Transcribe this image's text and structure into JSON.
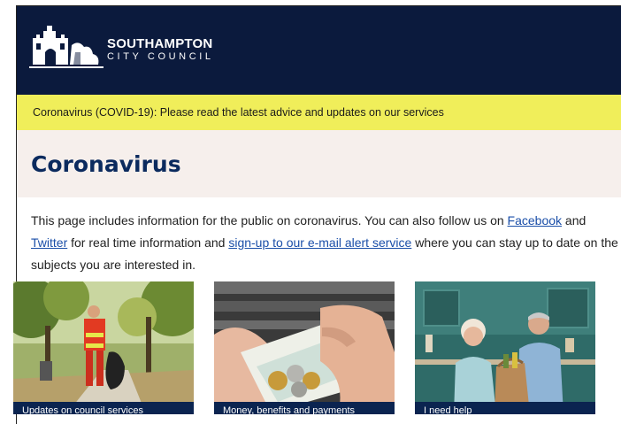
{
  "header": {
    "logo_line1": "SOUTHAMPTON",
    "logo_line2": "CITY COUNCIL"
  },
  "alert_banner": {
    "text": "Coronavirus (COVID-19): Please read the latest advice and updates on our services"
  },
  "page": {
    "title": "Coronavirus"
  },
  "intro": {
    "text_1": "This page includes information for the public on coronavirus. You can also follow us on ",
    "link_facebook": "Facebook",
    "text_2": " and ",
    "link_twitter": "Twitter",
    "text_3": " for real time information and ",
    "link_signup": "sign-up to our e-mail alert service",
    "text_4": " where you can stay up to date on the subjects you are interested in."
  },
  "cards": [
    {
      "label": "Updates on council services",
      "image": "worker-in-park-photo"
    },
    {
      "label": "Money, benefits and payments",
      "image": "money-in-hand-photo"
    },
    {
      "label": "I need help",
      "image": "couple-with-shopping-photo"
    }
  ],
  "colors": {
    "header_bg": "#0b1a3d",
    "alert_bg": "#f0ee5a",
    "title_bg": "#f6efec",
    "title_text": "#0b2a5e",
    "link": "#1a4ea8",
    "card_label_bg": "#0b2450"
  }
}
